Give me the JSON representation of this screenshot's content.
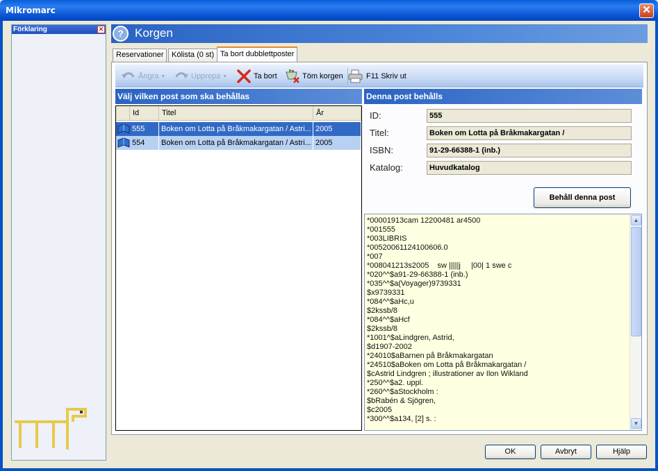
{
  "window": {
    "title": "Mikromarc"
  },
  "left_panel": {
    "title": "Förklaring"
  },
  "main": {
    "title": "Korgen"
  },
  "tabs": [
    {
      "label": "Reservationer"
    },
    {
      "label": "Kölista (0 st)"
    },
    {
      "label": "Ta bort dubblettposter",
      "active": true
    }
  ],
  "toolbar": {
    "undo": "Ångra",
    "redo": "Upprepa",
    "remove": "Ta bort",
    "empty": "Töm korgen",
    "print": "F11 Skriv ut"
  },
  "list": {
    "header": "Välj vilken post som ska behållas",
    "columns": [
      "Id",
      "Titel",
      "År"
    ],
    "rows": [
      {
        "id": "555",
        "title": "Boken om Lotta på Bråkmakargatan / Astri...",
        "year": "2005"
      },
      {
        "id": "554",
        "title": "Boken om Lotta på Bråkmakargatan / Astri...",
        "year": "2005"
      }
    ]
  },
  "detail": {
    "header": "Denna post behålls",
    "id_label": "ID:",
    "id_value": "555",
    "title_label": "Titel:",
    "title_value": "Boken om Lotta på Bråkmakargatan /",
    "isbn_label": "ISBN:",
    "isbn_value": "91-29-66388-1 (inb.)",
    "catalog_label": "Katalog:",
    "catalog_value": "Huvudkatalog",
    "keep_button": "Behåll denna post"
  },
  "marc_lines": [
    "*00001913cam 12200481 ar4500",
    "*001555",
    "*003LIBRIS",
    "*00520061124100606.0",
    "*007",
    "*008041213s2005    sw |||||j     |00| 1 swe c",
    "*020^^$a91-29-66388-1 (inb.)",
    "*035^^$a(Voyager)9739331",
    "$x9739331",
    "*084^^$aHc,u",
    "$2kssb/8",
    "*084^^$aHcf",
    "$2kssb/8",
    "*1001^$aLindgren, Astrid,",
    "$d1907-2002",
    "*24010$aBarnen på Bråkmakargatan",
    "*24510$aBoken om Lotta på Bråkmakargatan /",
    "$cAstrid Lindgren ; illustrationer av Ilon Wikland",
    "*250^^$a2. uppl.",
    "*260^^$aStockholm :",
    "$bRabén & Sjögren,",
    "$c2005",
    "*300^^$a134, [2] s. :"
  ],
  "buttons": {
    "ok": "OK",
    "cancel": "Avbryt",
    "help": "Hjälp"
  },
  "colors": {
    "titlebar": "#0553c8",
    "selection": "#316ac5",
    "marc_bg": "#ffffe1"
  }
}
